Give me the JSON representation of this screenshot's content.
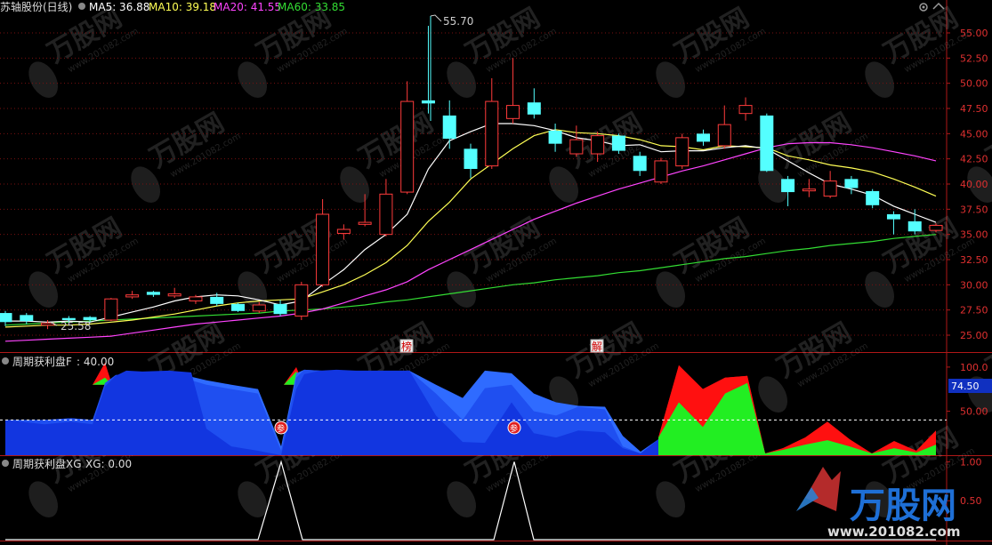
{
  "header": {
    "stock_title": "苏轴股份(日线)",
    "ma5": "MA5: 36.88",
    "ma10": "MA10: 39.18",
    "ma20": "MA20: 41.55",
    "ma60": "MA60: 33.85"
  },
  "panel2": {
    "title": "周期获利盘F",
    "value": ": 40.00",
    "badge": "74.50"
  },
  "panel3": {
    "title": "周期获利盘XG",
    "value": "XG: 0.00"
  },
  "annotations": {
    "high": "55.70",
    "low": "25.58",
    "bang": "榜",
    "jie": "解",
    "marker": "参"
  },
  "watermark": {
    "brand": "万股网",
    "url": "www.201082.com"
  },
  "colors": {
    "up": "#ff3b3b",
    "down": "#54ffff",
    "ma5": "#ffffff",
    "ma10": "#ffff55",
    "ma20": "#ff44ff",
    "ma60": "#33dd33",
    "axis": "#b01818"
  },
  "chart_data": [
    {
      "type": "candlestick",
      "ylim": [
        23.5,
        56.5
      ],
      "y_ticks": [
        "25.00",
        "27.50",
        "30.00",
        "32.50",
        "35.00",
        "37.50",
        "40.00",
        "42.50",
        "45.00",
        "47.50",
        "50.00",
        "52.50",
        "55.00"
      ],
      "candles": [
        {
          "o": 27.2,
          "c": 26.3,
          "h": 27.4,
          "l": 25.9
        },
        {
          "o": 27.0,
          "c": 26.4,
          "h": 27.2,
          "l": 26.1
        },
        {
          "o": 26.0,
          "c": 26.2,
          "h": 26.5,
          "l": 25.6
        },
        {
          "o": 26.7,
          "c": 26.5,
          "h": 26.9,
          "l": 26.2
        },
        {
          "o": 26.8,
          "c": 26.5,
          "h": 26.9,
          "l": 26.3
        },
        {
          "o": 26.5,
          "c": 28.6,
          "h": 28.7,
          "l": 26.4
        },
        {
          "o": 28.8,
          "c": 29.0,
          "h": 29.4,
          "l": 28.6
        },
        {
          "o": 29.3,
          "c": 29.0,
          "h": 29.4,
          "l": 28.8
        },
        {
          "o": 28.9,
          "c": 29.1,
          "h": 29.7,
          "l": 28.7
        },
        {
          "o": 28.4,
          "c": 28.8,
          "h": 29.0,
          "l": 28.1
        },
        {
          "o": 28.8,
          "c": 28.1,
          "h": 29.2,
          "l": 27.9
        },
        {
          "o": 28.1,
          "c": 27.4,
          "h": 28.2,
          "l": 27.3
        },
        {
          "o": 27.4,
          "c": 28.0,
          "h": 28.3,
          "l": 27.2
        },
        {
          "o": 28.1,
          "c": 27.1,
          "h": 28.5,
          "l": 26.9
        },
        {
          "o": 26.9,
          "c": 30.0,
          "h": 30.3,
          "l": 26.5
        },
        {
          "o": 30.0,
          "c": 37.0,
          "h": 38.5,
          "l": 29.8
        },
        {
          "o": 35.1,
          "c": 35.5,
          "h": 36.0,
          "l": 34.5
        },
        {
          "o": 36.0,
          "c": 36.2,
          "h": 39.0,
          "l": 35.8
        },
        {
          "o": 35.0,
          "c": 39.0,
          "h": 40.5,
          "l": 34.8
        },
        {
          "o": 39.2,
          "c": 48.2,
          "h": 50.2,
          "l": 39.0
        },
        {
          "o": 48.3,
          "c": 48.0,
          "h": 55.7,
          "l": 47.0
        },
        {
          "o": 46.8,
          "c": 44.5,
          "h": 48.3,
          "l": 43.5
        },
        {
          "o": 43.5,
          "c": 41.5,
          "h": 44.0,
          "l": 40.6
        },
        {
          "o": 41.8,
          "c": 48.2,
          "h": 50.5,
          "l": 41.5
        },
        {
          "o": 46.5,
          "c": 47.8,
          "h": 52.5,
          "l": 46.0
        },
        {
          "o": 48.1,
          "c": 46.9,
          "h": 49.5,
          "l": 46.5
        },
        {
          "o": 45.3,
          "c": 44.0,
          "h": 46.0,
          "l": 43.2
        },
        {
          "o": 43.0,
          "c": 44.4,
          "h": 45.8,
          "l": 42.7
        },
        {
          "o": 43.0,
          "c": 44.8,
          "h": 45.2,
          "l": 42.2
        },
        {
          "o": 44.8,
          "c": 43.3,
          "h": 45.0,
          "l": 43.0
        },
        {
          "o": 42.8,
          "c": 41.3,
          "h": 43.2,
          "l": 40.8
        },
        {
          "o": 40.2,
          "c": 42.3,
          "h": 42.6,
          "l": 40.0
        },
        {
          "o": 41.8,
          "c": 44.6,
          "h": 45.0,
          "l": 41.5
        },
        {
          "o": 45.0,
          "c": 44.2,
          "h": 45.4,
          "l": 43.8
        },
        {
          "o": 43.8,
          "c": 45.9,
          "h": 47.8,
          "l": 43.5
        },
        {
          "o": 47.0,
          "c": 47.8,
          "h": 48.6,
          "l": 46.3
        },
        {
          "o": 46.8,
          "c": 41.3,
          "h": 47.0,
          "l": 41.2
        },
        {
          "o": 40.5,
          "c": 39.2,
          "h": 40.8,
          "l": 37.8
        },
        {
          "o": 39.5,
          "c": 39.5,
          "h": 40.5,
          "l": 38.7
        },
        {
          "o": 38.8,
          "c": 40.3,
          "h": 41.3,
          "l": 38.6
        },
        {
          "o": 40.5,
          "c": 39.6,
          "h": 40.8,
          "l": 39.0
        },
        {
          "o": 39.3,
          "c": 37.9,
          "h": 39.5,
          "l": 37.6
        },
        {
          "o": 37.0,
          "c": 36.5,
          "h": 37.3,
          "l": 35.0
        },
        {
          "o": 36.3,
          "c": 35.3,
          "h": 37.5,
          "l": 35.0
        },
        {
          "o": 35.4,
          "c": 35.9,
          "h": 36.1,
          "l": 35.2
        }
      ],
      "ma5": [
        26.4,
        26.4,
        26.3,
        26.4,
        26.3,
        26.8,
        27.3,
        27.8,
        28.4,
        28.8,
        29.0,
        28.9,
        28.5,
        28.0,
        28.4,
        30.0,
        31.5,
        33.5,
        35.0,
        37.0,
        41.5,
        44.3,
        45.2,
        46.0,
        46.0,
        45.8,
        45.3,
        44.6,
        44.3,
        43.8,
        43.9,
        43.2,
        43.3,
        43.3,
        43.6,
        43.8,
        43.5,
        42.3,
        41.1,
        40.0,
        39.5,
        38.9,
        37.8,
        37.0,
        36.2
      ],
      "ma10": [
        25.8,
        25.9,
        26.0,
        26.0,
        26.1,
        26.3,
        26.5,
        26.8,
        27.1,
        27.5,
        27.9,
        28.2,
        28.4,
        28.5,
        28.6,
        29.3,
        30.0,
        31.0,
        32.2,
        33.9,
        36.3,
        38.2,
        40.5,
        42.0,
        43.5,
        44.8,
        45.4,
        45.1,
        45.0,
        44.8,
        44.4,
        43.8,
        43.7,
        43.4,
        43.8,
        43.7,
        43.6,
        42.8,
        42.4,
        41.9,
        41.6,
        41.2,
        40.5,
        39.7,
        38.8
      ],
      "ma20": [
        24.4,
        24.5,
        24.6,
        24.7,
        24.8,
        24.9,
        25.2,
        25.5,
        25.8,
        26.1,
        26.3,
        26.5,
        26.7,
        26.9,
        27.2,
        27.6,
        28.2,
        28.9,
        29.5,
        30.3,
        31.5,
        32.5,
        33.5,
        34.5,
        35.5,
        36.5,
        37.3,
        38.1,
        38.8,
        39.5,
        40.1,
        40.7,
        41.3,
        41.8,
        42.4,
        43.0,
        43.6,
        44.0,
        44.1,
        44.1,
        43.9,
        43.6,
        43.2,
        42.8,
        42.3
      ],
      "ma60": [
        26.0,
        26.1,
        26.2,
        26.3,
        26.4,
        26.5,
        26.6,
        26.7,
        26.8,
        26.9,
        27.0,
        27.1,
        27.2,
        27.4,
        27.5,
        27.6,
        27.8,
        28.0,
        28.3,
        28.5,
        28.8,
        29.1,
        29.4,
        29.7,
        30.0,
        30.2,
        30.5,
        30.7,
        30.9,
        31.2,
        31.4,
        31.7,
        32.0,
        32.3,
        32.6,
        32.8,
        33.1,
        33.4,
        33.6,
        33.9,
        34.1,
        34.3,
        34.6,
        34.8,
        35.0
      ]
    },
    {
      "type": "area",
      "title": "周期获利盘F",
      "ylim": [
        0,
        113
      ],
      "y_ticks": [
        "50.00",
        "100.0"
      ],
      "threshold": 40.0,
      "x": [
        6,
        50,
        80,
        104,
        118,
        130,
        142,
        160,
        190,
        215,
        232,
        260,
        290,
        316,
        333,
        342,
        360,
        378,
        400,
        430,
        460,
        490,
        520,
        545,
        575,
        600,
        625,
        650,
        680,
        700,
        720,
        740,
        763,
        790,
        815,
        840,
        860,
        880,
        905,
        930,
        955,
        980,
        1005,
        1030,
        1052
      ],
      "dark": [
        40,
        35,
        38,
        35,
        78,
        90,
        96,
        95,
        96,
        94,
        30,
        10,
        5,
        0,
        75,
        92,
        96,
        97,
        96,
        96,
        96,
        45,
        15,
        14,
        60,
        25,
        20,
        28,
        26,
        8,
        2,
        18,
        78,
        65,
        75,
        75,
        1,
        4,
        3,
        6,
        3,
        1,
        2,
        1,
        2
      ],
      "mid": [
        40,
        40,
        42,
        40,
        82,
        91,
        92,
        90,
        88,
        85,
        80,
        75,
        70,
        5,
        88,
        97,
        96,
        95,
        93,
        95,
        96,
        70,
        40,
        76,
        80,
        50,
        45,
        55,
        52,
        10,
        2,
        18,
        78,
        65,
        75,
        75,
        1,
        4,
        3,
        6,
        3,
        1,
        2,
        1,
        2
      ],
      "light": [
        40,
        40,
        42,
        40,
        80,
        88,
        90,
        91,
        90,
        89,
        85,
        80,
        75,
        10,
        93,
        97,
        96,
        95,
        93,
        95,
        96,
        80,
        65,
        96,
        93,
        70,
        60,
        56,
        55,
        22,
        4,
        18,
        78,
        65,
        75,
        75,
        1,
        4,
        3,
        6,
        3,
        1,
        2,
        1,
        2
      ],
      "green": [
        null,
        null,
        null,
        null,
        88,
        null,
        null,
        null,
        null,
        null,
        null,
        null,
        null,
        null,
        95,
        null,
        null,
        null,
        null,
        null,
        null,
        null,
        null,
        null,
        null,
        null,
        null,
        null,
        null,
        null,
        null,
        20,
        60,
        32,
        70,
        82,
        2,
        6,
        12,
        17,
        10,
        2,
        8,
        3,
        12
      ],
      "red": [
        null,
        null,
        null,
        null,
        105,
        null,
        null,
        null,
        null,
        null,
        null,
        null,
        null,
        null,
        100,
        null,
        null,
        null,
        null,
        null,
        null,
        null,
        null,
        null,
        null,
        null,
        null,
        null,
        null,
        null,
        null,
        20,
        102,
        75,
        88,
        90,
        2,
        8,
        20,
        38,
        18,
        2,
        16,
        5,
        28
      ],
      "markers_x": [
        316,
        578
      ]
    },
    {
      "type": "line",
      "title": "周期获利盘XG",
      "ylim": [
        0,
        1.05
      ],
      "y_ticks": [
        "0.50",
        "1.00"
      ],
      "x": [
        6,
        290,
        316,
        340,
        555,
        578,
        600,
        1052
      ],
      "values": [
        0,
        0,
        1,
        0,
        0,
        1,
        0,
        0
      ]
    }
  ]
}
